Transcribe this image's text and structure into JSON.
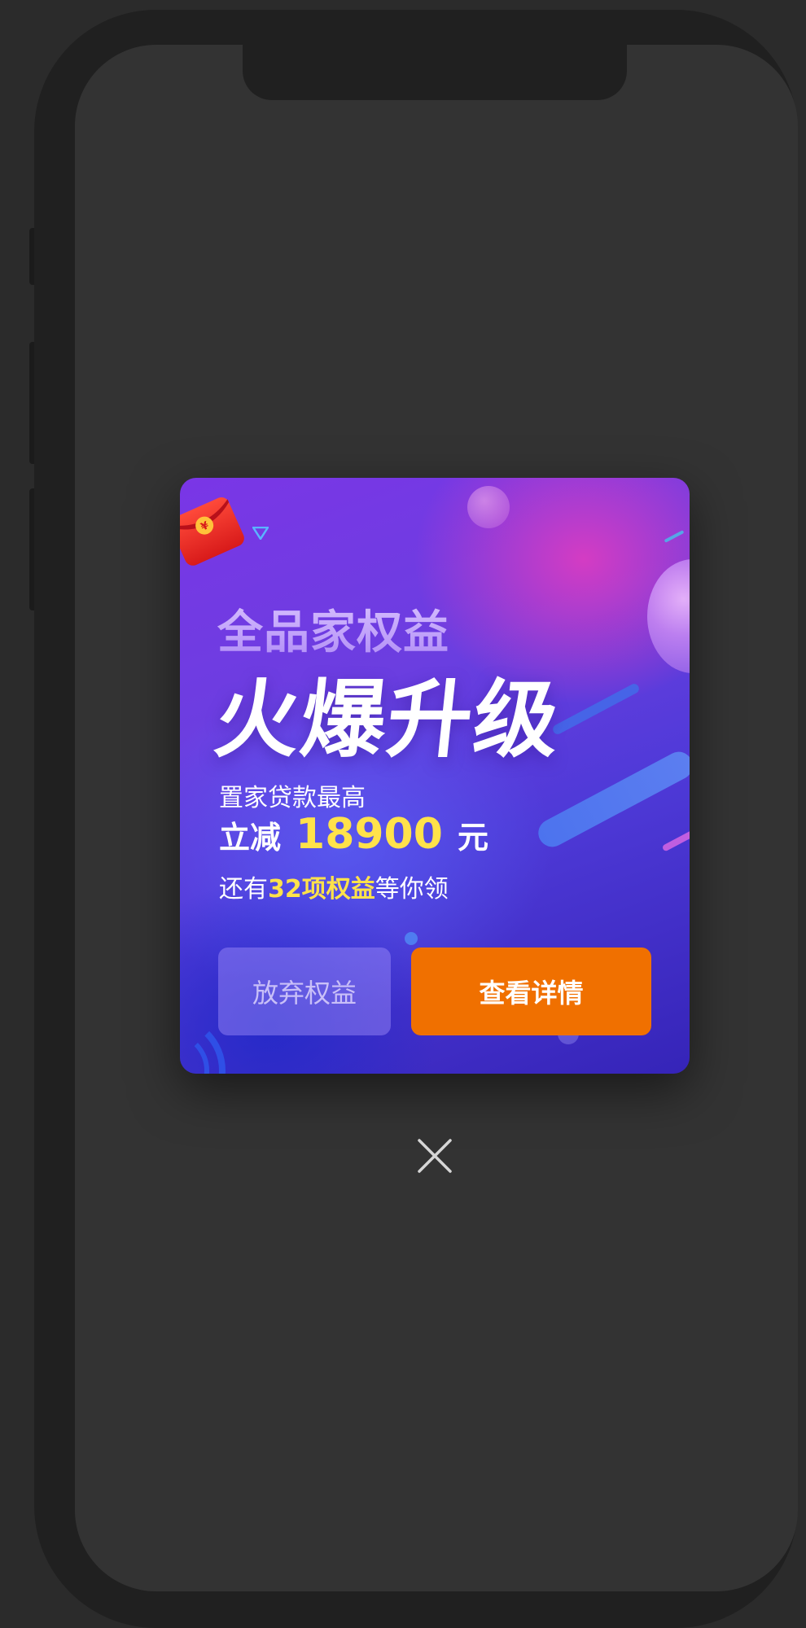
{
  "popup": {
    "subtitle": "全品家权益",
    "headline": "火爆升级",
    "offer_prefix": "置家贷款最高",
    "discount_label": "立减",
    "discount_amount": "18900",
    "discount_unit": "元",
    "benefits_prefix": "还有",
    "benefits_highlight": "32项权益",
    "benefits_suffix": "等你领",
    "decline_button": "放弃权益",
    "detail_button": "查看详情"
  },
  "icons": {
    "red_envelope": "red-envelope-icon",
    "close": "close-icon",
    "triangle": "triangle-icon"
  },
  "colors": {
    "accent_yellow": "#ffe24a",
    "button_orange": "#f07000",
    "card_purple": "#6b3ee0",
    "background_gray": "#333333"
  }
}
